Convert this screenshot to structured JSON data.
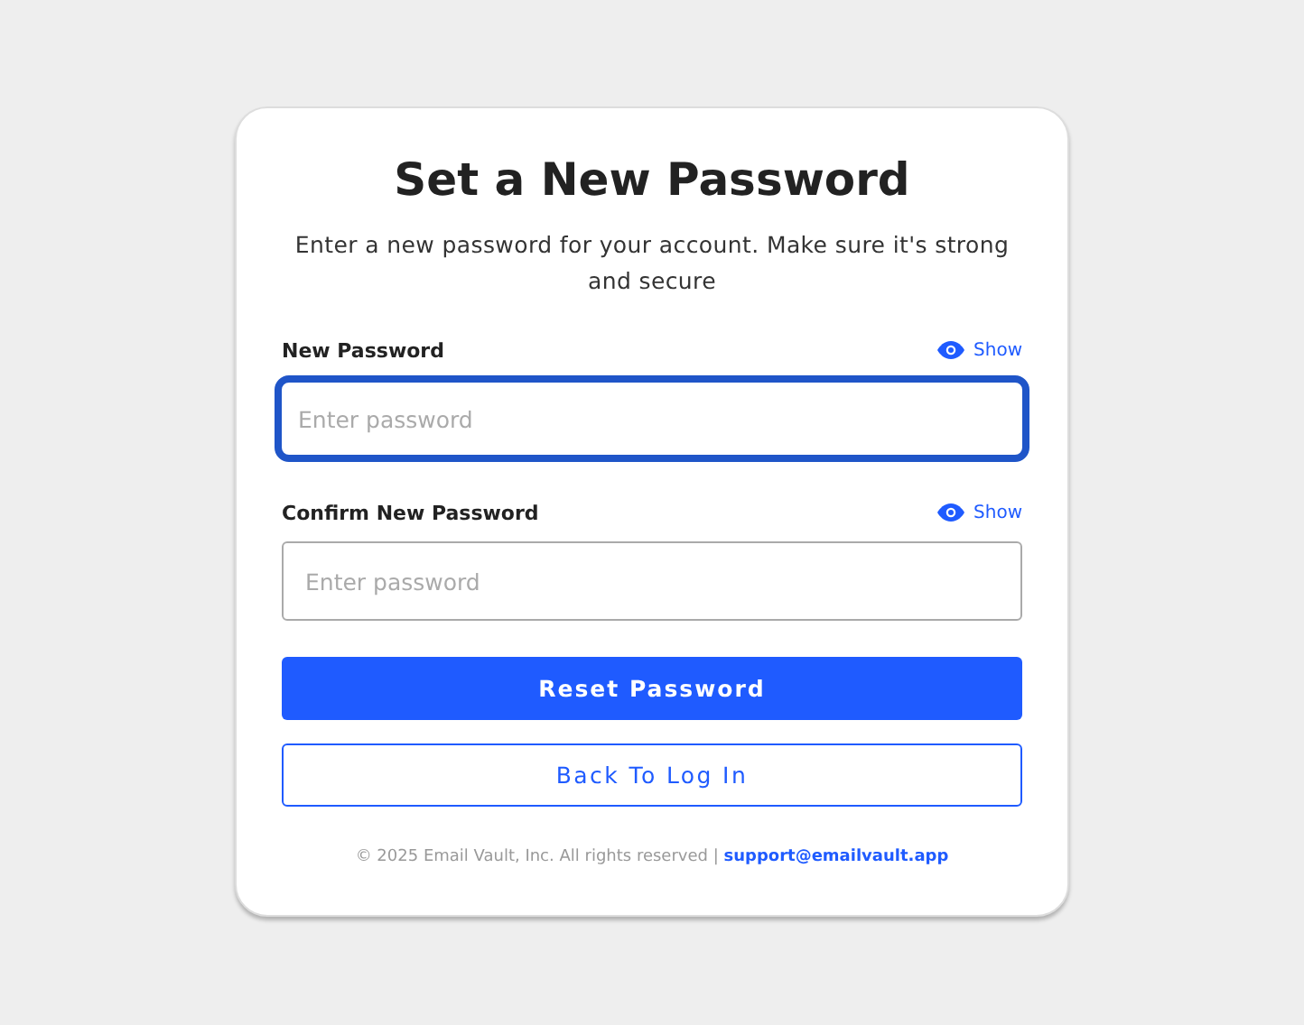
{
  "title": "Set a New Password",
  "subtitle": "Enter a new password for your account. Make sure it's strong and secure",
  "fields": [
    {
      "label": "New Password",
      "toggle": "Show",
      "placeholder": "Enter password",
      "focused": true
    },
    {
      "label": "Confirm New Password",
      "toggle": "Show",
      "placeholder": "Enter password",
      "focused": false
    }
  ],
  "primary_button": "Reset Password",
  "secondary_button": "Back To Log In",
  "footer": {
    "text": "© 2025 Email Vault, Inc. All rights reserved |",
    "link": "support@emailvault.app"
  }
}
